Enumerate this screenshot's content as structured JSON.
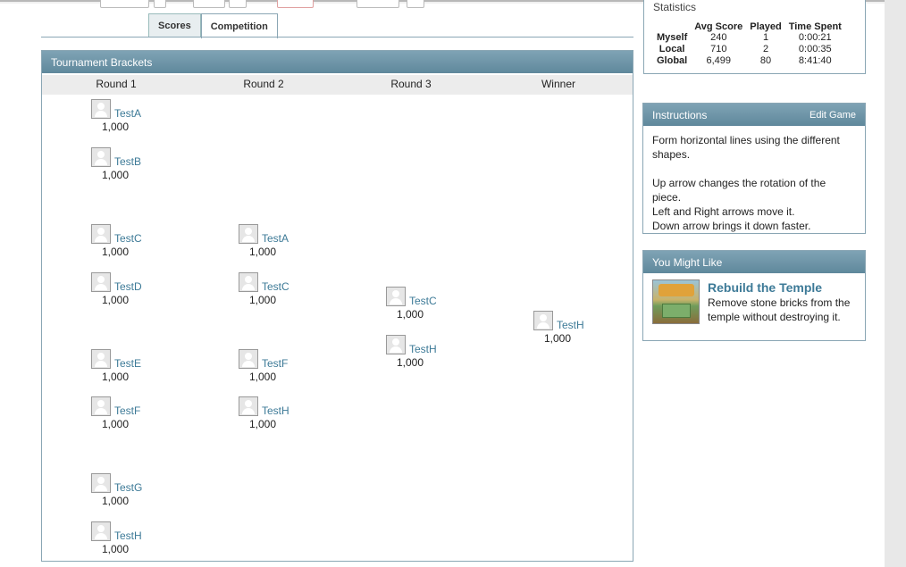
{
  "tabs": [
    {
      "label": "Scores",
      "active": false
    },
    {
      "label": "Competition",
      "active": true
    }
  ],
  "brackets": {
    "title": "Tournament Brackets",
    "rounds": [
      "Round 1",
      "Round 2",
      "Round 3",
      "Winner"
    ],
    "round1": [
      {
        "name": "TestA",
        "score": "1,000"
      },
      {
        "name": "TestB",
        "score": "1,000"
      },
      {
        "name": "TestC",
        "score": "1,000"
      },
      {
        "name": "TestD",
        "score": "1,000"
      },
      {
        "name": "TestE",
        "score": "1,000"
      },
      {
        "name": "TestF",
        "score": "1,000"
      },
      {
        "name": "TestG",
        "score": "1,000"
      },
      {
        "name": "TestH",
        "score": "1,000"
      }
    ],
    "round2": [
      {
        "name": "TestA",
        "score": "1,000"
      },
      {
        "name": "TestC",
        "score": "1,000"
      },
      {
        "name": "TestF",
        "score": "1,000"
      },
      {
        "name": "TestH",
        "score": "1,000"
      }
    ],
    "round3": [
      {
        "name": "TestC",
        "score": "1,000"
      },
      {
        "name": "TestH",
        "score": "1,000"
      }
    ],
    "winner": [
      {
        "name": "TestH",
        "score": "1,000"
      }
    ]
  },
  "statistics": {
    "title": "Statistics",
    "columns": [
      "Avg Score",
      "Played",
      "Time Spent"
    ],
    "rows": [
      {
        "label": "Myself",
        "avg": "240",
        "played": "1",
        "time": "0:00:21"
      },
      {
        "label": "Local",
        "avg": "710",
        "played": "2",
        "time": "0:00:35"
      },
      {
        "label": "Global",
        "avg": "6,499",
        "played": "80",
        "time": "8:41:40"
      }
    ]
  },
  "instructions": {
    "title": "Instructions",
    "edit_link": "Edit Game",
    "line1": "Form horizontal lines using the different shapes.",
    "line2": "Up arrow changes the rotation of the piece.",
    "line3": "Left and Right arrows move it.",
    "line4": "Down arrow brings it down faster."
  },
  "you_might_like": {
    "title": "You Might Like",
    "game_title": "Rebuild the Temple",
    "game_desc": "Remove stone bricks from the temple without destroying it."
  }
}
